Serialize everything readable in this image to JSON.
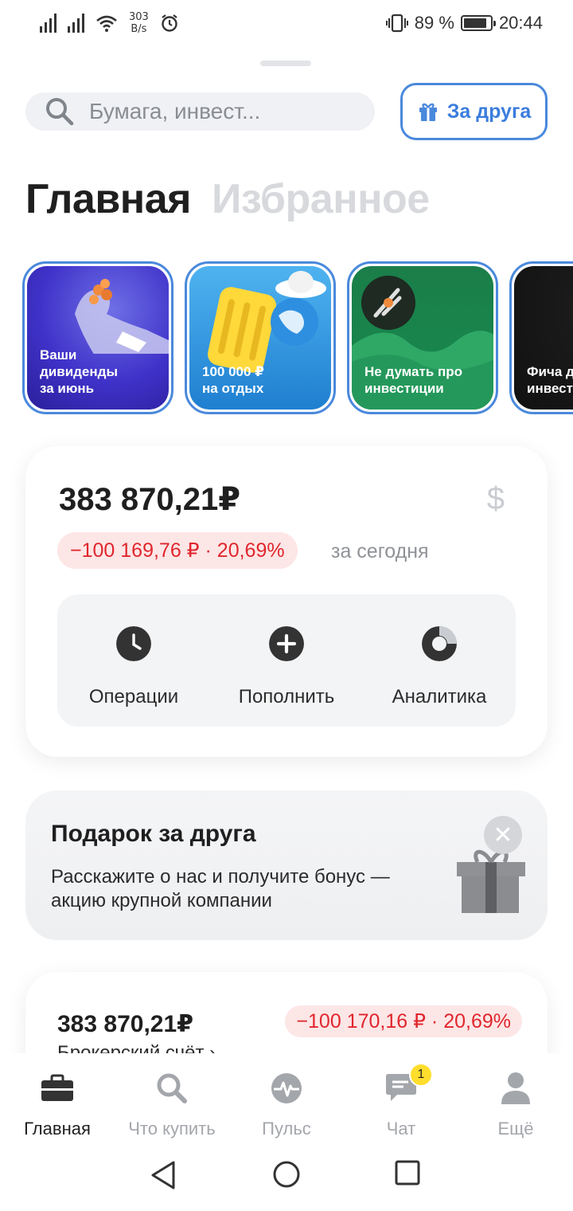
{
  "status_bar": {
    "speed_value": "303",
    "speed_unit": "B/s",
    "battery": "89 %",
    "time": "20:44",
    "battery_level": 0.89
  },
  "search": {
    "placeholder": "Бумага, инвест..."
  },
  "invite_button": {
    "label": "За друга",
    "icon": "gift-icon"
  },
  "tabs": [
    {
      "label": "Главная",
      "active": true
    },
    {
      "label": "Избранное",
      "active": false
    }
  ],
  "stories": [
    {
      "label": "Ваши\nдивиденды\nза июнь"
    },
    {
      "label": "100 000 ₽\nна отдых"
    },
    {
      "label": "Не думать про\nинвестиции"
    },
    {
      "label": "Фича д\nинвесто"
    }
  ],
  "portfolio": {
    "total": "383 870,21₽",
    "currency_icon": "$",
    "change": "−100 169,76 ₽ · 20,69%",
    "period": "за сегодня",
    "actions": [
      {
        "label": "Операции",
        "icon": "clock-icon"
      },
      {
        "label": "Пополнить",
        "icon": "plus-icon"
      },
      {
        "label": "Аналитика",
        "icon": "donut-chart-icon"
      }
    ]
  },
  "gift_promo": {
    "title": "Подарок за друга",
    "text": "Расскажите о нас и получите бонус — акцию крупной компании"
  },
  "account": {
    "total": "383 870,21₽",
    "change": "−100 170,16 ₽ · 20,69%",
    "name": "Брокерский счёт ›"
  },
  "bottom_nav": [
    {
      "label": "Главная",
      "icon": "briefcase-icon",
      "active": true
    },
    {
      "label": "Что купить",
      "icon": "search-icon",
      "active": false
    },
    {
      "label": "Пульс",
      "icon": "pulse-icon",
      "active": false
    },
    {
      "label": "Чат",
      "icon": "chat-icon",
      "active": false,
      "badge": "1"
    },
    {
      "label": "Ещё",
      "icon": "profile-icon",
      "active": false
    }
  ],
  "colors": {
    "accent": "#4a89dc",
    "negative": "#e0262d",
    "badge": "#ffdd2d"
  }
}
